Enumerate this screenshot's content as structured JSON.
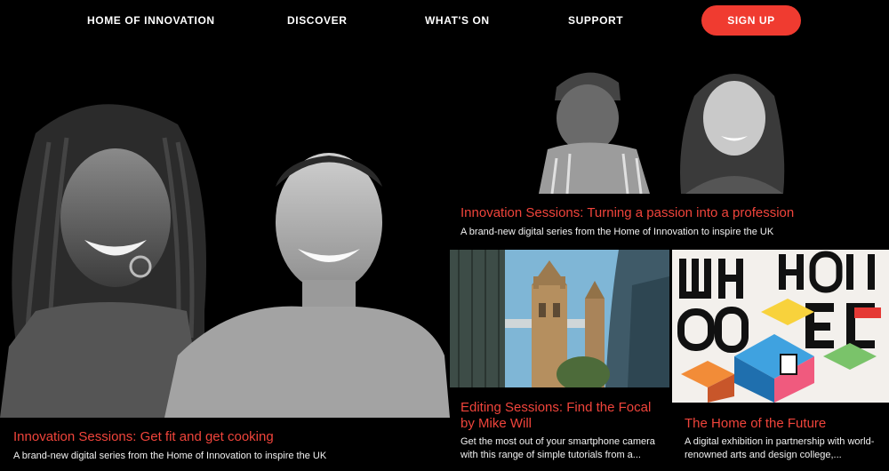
{
  "nav": {
    "items": [
      {
        "label": "HOME OF INNOVATION"
      },
      {
        "label": "DISCOVER"
      },
      {
        "label": "WHAT'S ON"
      },
      {
        "label": "SUPPORT"
      }
    ],
    "signup_label": "SIGN UP"
  },
  "cards": {
    "fitness": {
      "title": "Innovation Sessions: Get fit and get cooking",
      "desc": "A brand-new digital series from the Home of Innovation to inspire the UK"
    },
    "passion": {
      "title": "Innovation Sessions: Turning a passion into a profession",
      "desc": "A brand-new digital series from the Home of Innovation to inspire the UK"
    },
    "editing": {
      "title": "Editing Sessions: Find the Focal by Mike Will",
      "desc": "Get the most out of your smartphone camera with this range of simple tutorials from a..."
    },
    "future": {
      "title": "The Home of the Future",
      "desc": "A digital exhibition in partnership with world-renowned arts and design college,..."
    }
  },
  "colors": {
    "accent": "#f03b30",
    "background": "#000000"
  }
}
